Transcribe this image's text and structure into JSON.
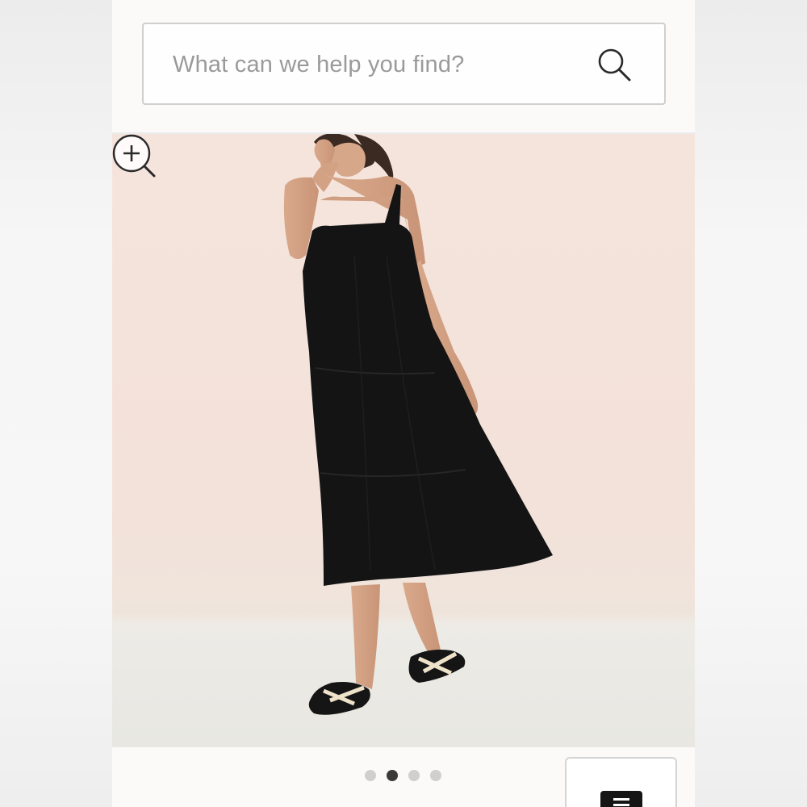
{
  "search": {
    "placeholder": "What can we help you find?",
    "icon": "search-icon"
  },
  "product_gallery": {
    "image_alt": "Woman wearing a black tiered sleeveless midi dress with black and cream slide sandals",
    "zoom_icon": "zoom-in-icon",
    "total_images": 4,
    "active_index": 2
  },
  "menu": {
    "icon": "menu-icon"
  },
  "colors": {
    "background": "#fbfaf8",
    "hero_wall": "#f3e2d9",
    "dress": "#141414",
    "active_dot": "#3a3a3a",
    "inactive_dot": "#cfcfcf"
  }
}
